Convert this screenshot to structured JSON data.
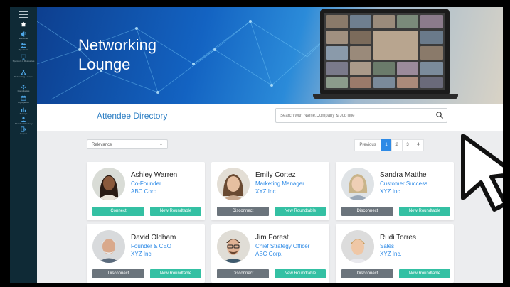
{
  "sidebar": {
    "items": [
      {
        "label": "Welcome",
        "icon": "megaphone-icon"
      },
      {
        "label": "Speakers",
        "icon": "users-icon"
      },
      {
        "label": "Sponsors & Resources",
        "icon": "monitor-icon"
      },
      {
        "label": "Networking Lounge",
        "icon": "network-icon"
      },
      {
        "label": "Roundtables",
        "icon": "group-icon"
      },
      {
        "label": "My Agenda",
        "icon": "calendar-icon"
      },
      {
        "label": "Surveys",
        "icon": "chart-icon"
      },
      {
        "label": "Attendee Directory",
        "icon": "person-icon"
      },
      {
        "label": "Logout",
        "icon": "logout-icon"
      }
    ]
  },
  "banner": {
    "line1": "Networking",
    "line2": "Lounge"
  },
  "directory": {
    "title": "Attendee Directory"
  },
  "search": {
    "placeholder": "Search with Name,Company & JobTitle"
  },
  "sort": {
    "selected": "Relevance"
  },
  "pagination": {
    "prev_label": "Previous",
    "pages": [
      "1",
      "2",
      "3",
      "4"
    ],
    "active": "1"
  },
  "buttons": {
    "connect": "Connect",
    "disconnect": "Disconnect",
    "new_roundtable": "New Roundtable"
  },
  "attendees": [
    {
      "name": "Ashley Warren",
      "title": "Co-Founder",
      "company": "ABC Corp."
    },
    {
      "name": "Emily Cortez",
      "title": "Marketing Manager",
      "company": "XYZ Inc."
    },
    {
      "name": "Sandra Matthe",
      "title": "Customer Success",
      "company": "XYZ Inc."
    },
    {
      "name": "David Oldham",
      "title": "Founder & CEO",
      "company": "XYZ Inc."
    },
    {
      "name": "Jim Forest",
      "title": "Chief Strategy Officer",
      "company": "ABC Corp."
    },
    {
      "name": "Rudi Torres",
      "title": "Sales",
      "company": "XYZ Inc."
    }
  ],
  "colors": {
    "accent": "#2d8ae6",
    "teal": "#34c0a3",
    "gray": "#6b747c",
    "sidebar": "#0f2a36"
  }
}
